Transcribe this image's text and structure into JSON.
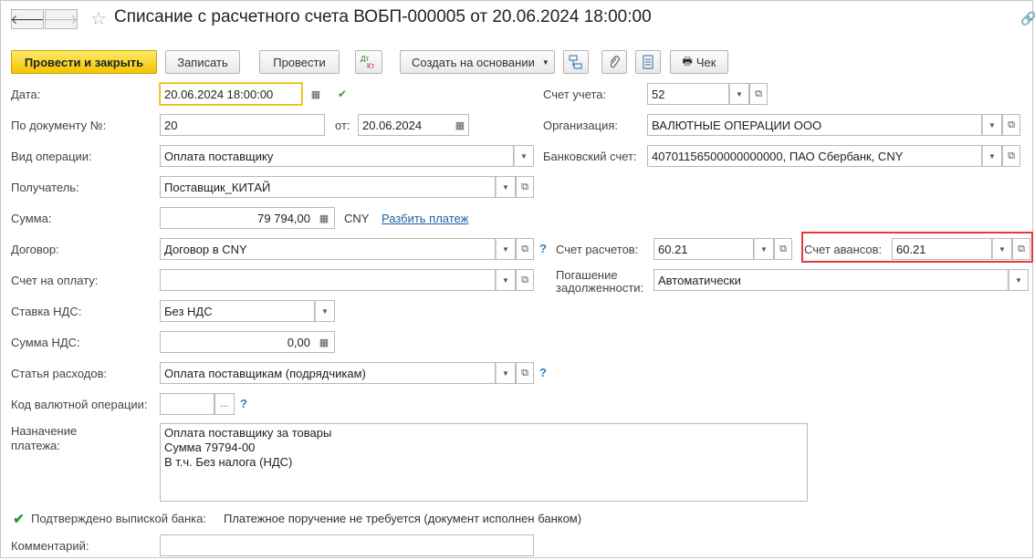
{
  "header": {
    "title": "Списание с расчетного счета ВОБП-000005 от 20.06.2024 18:00:00",
    "back_icon": "arrow-left",
    "forward_icon": "arrow-right"
  },
  "toolbar": {
    "post_close": "Провести и закрыть",
    "save": "Записать",
    "post": "Провести",
    "dtkt_top": "Дт",
    "dtkt_bottom": "Кт",
    "create_based": "Создать на основании",
    "check": "Чек"
  },
  "form": {
    "date": {
      "label": "Дата:",
      "value": "20.06.2024 18:00:00"
    },
    "doc_no": {
      "label": "По документу №:",
      "value": "20"
    },
    "from": {
      "label": "от:",
      "value": "20.06.2024"
    },
    "operation": {
      "label": "Вид операции:",
      "value": "Оплата поставщику"
    },
    "recipient": {
      "label": "Получатель:",
      "value": "Поставщик_КИТАЙ"
    },
    "amount": {
      "label": "Сумма:",
      "value": "79 794,00",
      "currency": "CNY",
      "split_link": "Разбить платеж"
    },
    "contract": {
      "label": "Договор:",
      "value": "Договор в CNY"
    },
    "invoice": {
      "label": "Счет на оплату:",
      "value": ""
    },
    "vat_rate": {
      "label": "Ставка НДС:",
      "value": "Без НДС"
    },
    "vat_sum": {
      "label": "Сумма НДС:",
      "value": "0,00"
    },
    "expense": {
      "label": "Статья расходов:",
      "value": "Оплата поставщикам (подрядчикам)"
    },
    "currency_code": {
      "label": "Код валютной операции:",
      "value": "",
      "btn": "..."
    },
    "purpose": {
      "label_line1": "Назначение",
      "label_line2": "платежа:",
      "lines": [
        "Оплата поставщику за товары",
        "Сумма 79794-00",
        "В т.ч. Без налога (НДС)"
      ]
    },
    "confirmed": {
      "label": "Подтверждено выпиской банка:",
      "note": "Платежное поручение не требуется (документ исполнен банком)",
      "checked": true
    },
    "comment": {
      "label": "Комментарий:",
      "value": ""
    },
    "account": {
      "label": "Счет учета:",
      "value": "52"
    },
    "organization": {
      "label": "Организация:",
      "value": "ВАЛЮТНЫЕ ОПЕРАЦИИ ООО"
    },
    "bank_account": {
      "label": "Банковский счет:",
      "value": "40701156500000000000, ПАО Сбербанк, CNY"
    },
    "settlement_account": {
      "label": "Счет расчетов:",
      "value": "60.21"
    },
    "advance_account": {
      "label": "Счет авансов:",
      "value": "60.21"
    },
    "repayment": {
      "label_line1": "Погашение",
      "label_line2": "задолженности:",
      "value": "Автоматически"
    },
    "help_mark": "?"
  },
  "colors": {
    "primary": "#f2c500",
    "highlight": "#e03a3a",
    "link": "#1a63a8",
    "check": "#2a9a2a"
  }
}
